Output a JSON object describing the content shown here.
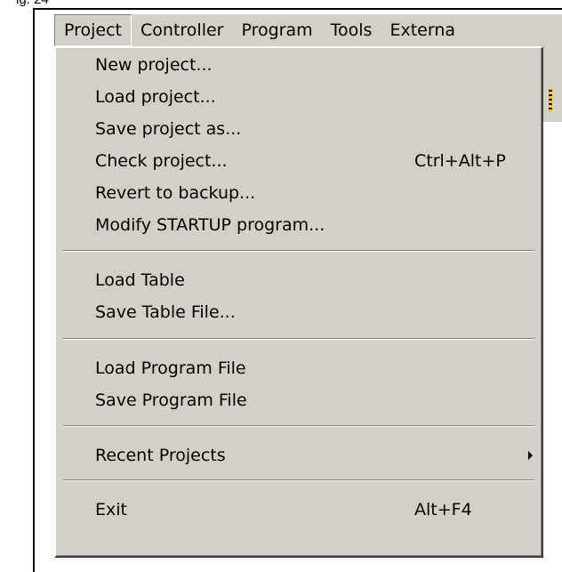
{
  "figure_label": "ig. 24",
  "menubar": {
    "items": [
      "Project",
      "Controller",
      "Program",
      "Tools",
      "Externa"
    ]
  },
  "menu": {
    "items": [
      {
        "label": "New project...",
        "shortcut": ""
      },
      {
        "label": "Load project...",
        "shortcut": ""
      },
      {
        "label": "Save project as...",
        "shortcut": ""
      },
      {
        "label": "Check project...",
        "shortcut": "Ctrl+Alt+P"
      },
      {
        "label": "Revert to backup...",
        "shortcut": ""
      },
      {
        "label": "Modify STARTUP program...",
        "shortcut": ""
      },
      {
        "label": "Load Table",
        "shortcut": ""
      },
      {
        "label": "Save Table File...",
        "shortcut": ""
      },
      {
        "label": "Load Program File",
        "shortcut": ""
      },
      {
        "label": "Save Program File",
        "shortcut": ""
      },
      {
        "label": "Recent Projects",
        "shortcut": ""
      },
      {
        "label": "Exit",
        "shortcut": "Alt+F4"
      }
    ]
  },
  "colors": {
    "menu_bg": "#d4d0c8",
    "frame": "#000000"
  },
  "icons": {
    "submenu_arrow": "triangle-right-icon"
  }
}
